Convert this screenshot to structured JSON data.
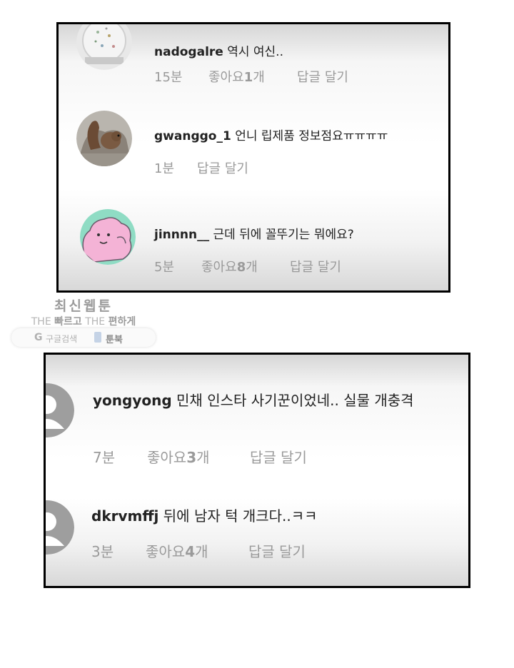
{
  "panel1": {
    "comments": [
      {
        "username": "nadogalre",
        "text": "역시 여신..",
        "time": "15분",
        "likes_label": "좋아요",
        "likes_count": "1",
        "likes_unit": "개",
        "reply": "답글 달기"
      },
      {
        "username": "gwanggo_1",
        "text": "언니 립제품 정보점요ㅠㅠㅠㅠ",
        "time": "1분",
        "reply": "답글 달기"
      },
      {
        "username": "jinnnn__",
        "text": "근데 뒤에 꼴뚜기는 뭐에요?",
        "time": "5분",
        "likes_label": "좋아요",
        "likes_count": "8",
        "likes_unit": "개",
        "reply": "답글 달기"
      }
    ]
  },
  "watermark": {
    "title": "최신웹툰",
    "the1": "THE",
    "faster": "빠르고",
    "the2": "THE",
    "easier": "편하게",
    "google": "구글검색",
    "google_icon": "G",
    "toonbook": "툰북"
  },
  "panel2": {
    "comments": [
      {
        "username": "yongyong",
        "text": "민채 인스타 사기꾼이었네.. 실물 개충격",
        "time": "7분",
        "likes_label": "좋아요",
        "likes_count": "3",
        "likes_unit": "개",
        "reply": "답글 달기"
      },
      {
        "username": "dkrvmffj",
        "text": "뒤에 남자 턱 개크다..ㅋㅋ",
        "time": "3분",
        "likes_label": "좋아요",
        "likes_count": "4",
        "likes_unit": "개",
        "reply": "답글 달기"
      }
    ]
  }
}
